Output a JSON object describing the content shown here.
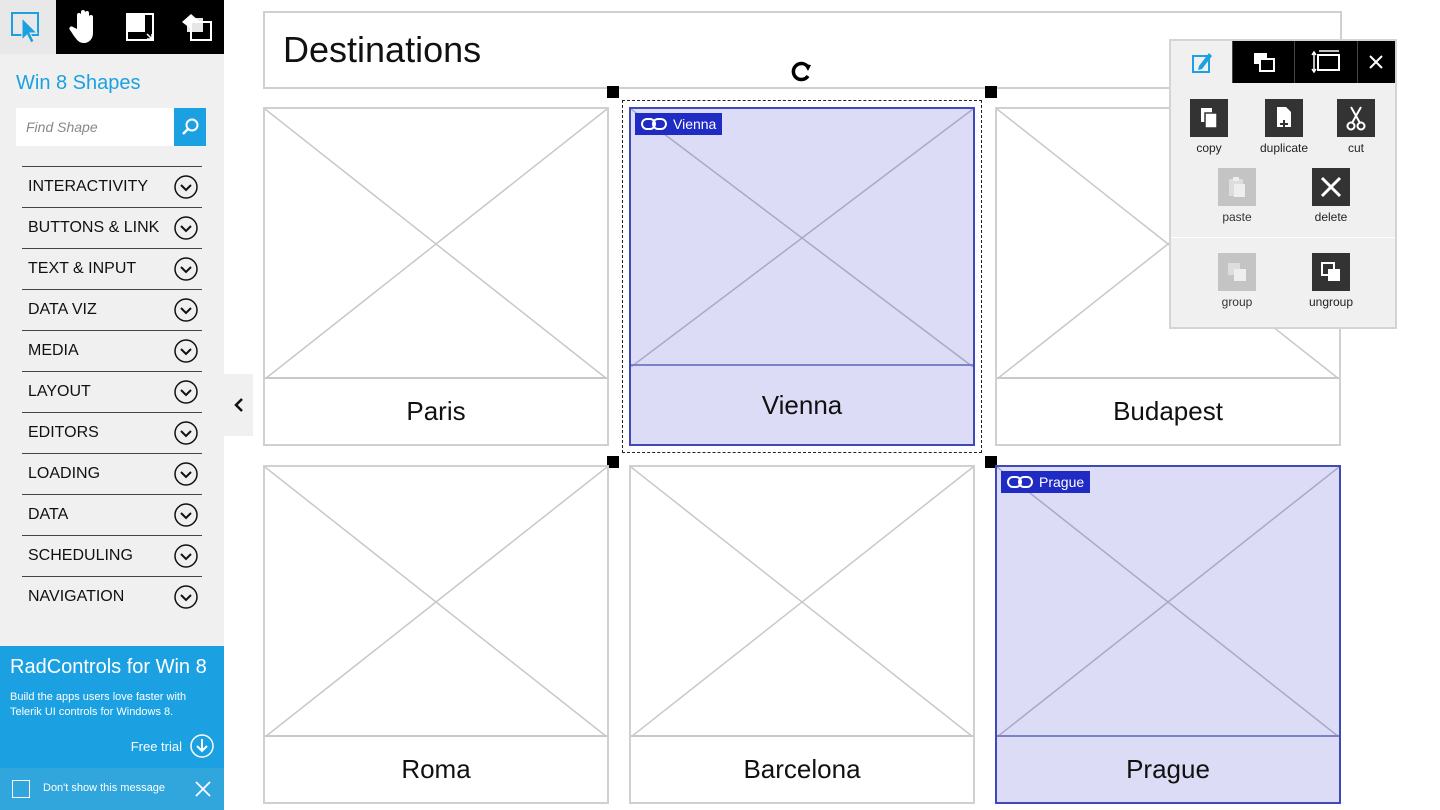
{
  "sidebar": {
    "title": "Win 8 Shapes",
    "search_placeholder": "Find Shape",
    "categories": [
      {
        "label": "INTERACTIVITY"
      },
      {
        "label": "BUTTONS & LINK"
      },
      {
        "label": "TEXT & INPUT"
      },
      {
        "label": "DATA VIZ"
      },
      {
        "label": "MEDIA"
      },
      {
        "label": "LAYOUT"
      },
      {
        "label": "EDITORS"
      },
      {
        "label": "LOADING"
      },
      {
        "label": "DATA"
      },
      {
        "label": "SCHEDULING"
      },
      {
        "label": "NAVIGATION"
      }
    ]
  },
  "promo": {
    "title": "RadControls for Win 8",
    "text": "Build the apps users love faster with Telerik UI controls for Windows 8.",
    "trial_label": "Free trial",
    "dont_show_label": "Don't show this message"
  },
  "canvas": {
    "heading": "Destinations",
    "cards": [
      {
        "label": "Paris"
      },
      {
        "label": "Vienna",
        "link": "Vienna"
      },
      {
        "label": "Budapest"
      },
      {
        "label": "Roma"
      },
      {
        "label": "Barcelona"
      },
      {
        "label": "Prague",
        "link": "Prague"
      }
    ]
  },
  "panel": {
    "actions": {
      "copy": "copy",
      "duplicate": "duplicate",
      "cut": "cut",
      "paste": "paste",
      "delete": "delete",
      "group": "group",
      "ungroup": "ungroup"
    }
  },
  "colors": {
    "accent": "#1ba1e2",
    "selection_fill": "#dcdcf6",
    "selection_border": "#3f49b8",
    "link_badge": "#1f2bc2"
  }
}
